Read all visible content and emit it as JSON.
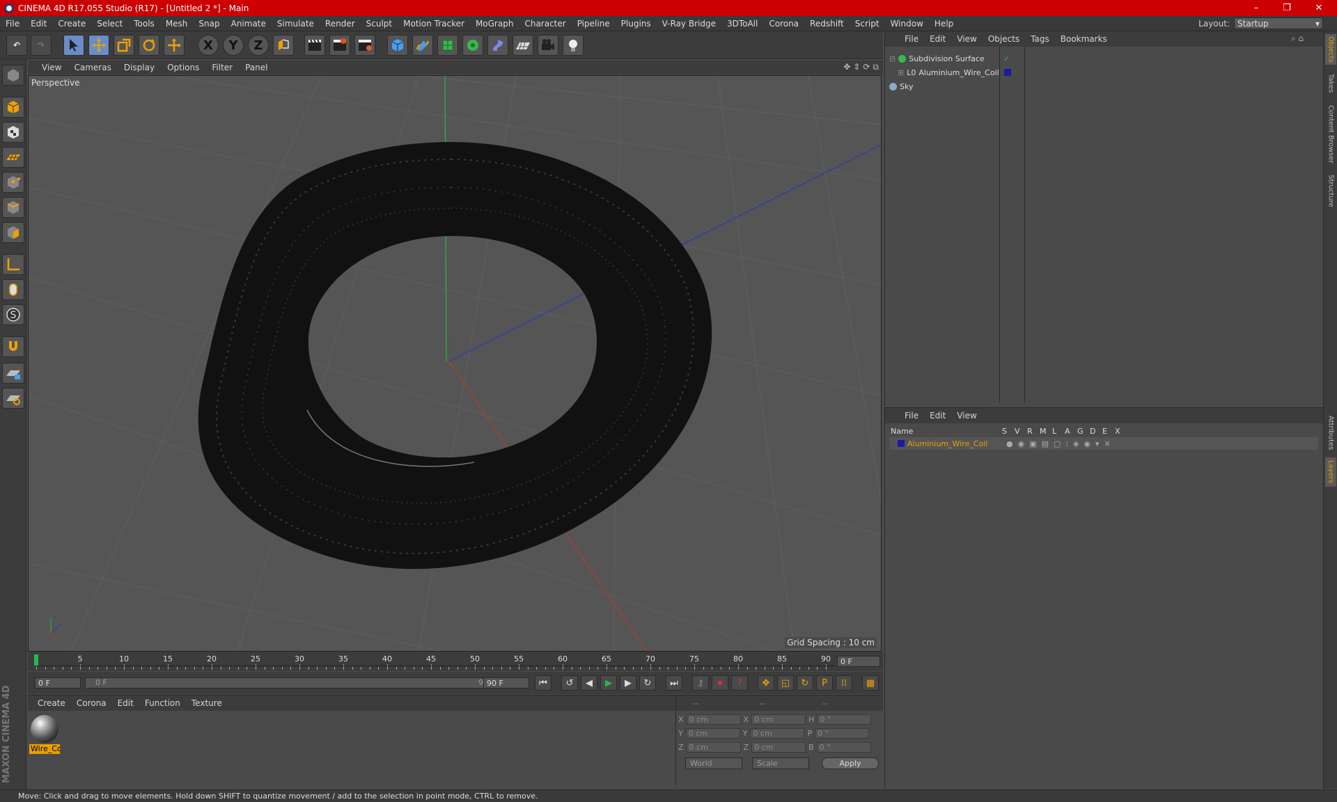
{
  "title": "CINEMA 4D R17.055 Studio (R17) - [Untitled 2 *] - Main",
  "window_controls": {
    "minimize": "–",
    "restore": "❐",
    "close": "✕"
  },
  "menu": [
    "File",
    "Edit",
    "Create",
    "Select",
    "Tools",
    "Mesh",
    "Snap",
    "Animate",
    "Simulate",
    "Render",
    "Sculpt",
    "Motion Tracker",
    "MoGraph",
    "Character",
    "Pipeline",
    "Plugins",
    "V-Ray Bridge",
    "3DToAll",
    "Corona",
    "Redshift",
    "Script",
    "Window",
    "Help"
  ],
  "layout": {
    "label": "Layout:",
    "value": "Startup"
  },
  "toolbar_icons": {
    "undo": "undo-icon",
    "redo": "redo-icon",
    "live_selection": "cursor-icon",
    "move": "move-icon",
    "scale": "scale-icon",
    "rotate": "rotate-icon",
    "axis_x": "X",
    "axis_y": "Y",
    "axis_z": "Z"
  },
  "viewport": {
    "menu": [
      "View",
      "Cameras",
      "Display",
      "Options",
      "Filter",
      "Panel"
    ],
    "label": "Perspective",
    "grid_spacing": "Grid Spacing : 10 cm"
  },
  "timeline": {
    "ticks": [
      "0",
      "5",
      "10",
      "15",
      "20",
      "25",
      "30",
      "35",
      "40",
      "45",
      "50",
      "55",
      "60",
      "65",
      "70",
      "75",
      "80",
      "85",
      "90"
    ],
    "current_frame": "0 F",
    "start_frame": "0 F",
    "range_slider_start": "0 F",
    "range_slider_end": "90 F",
    "end_frame": "90 F"
  },
  "material_panel": {
    "menu": [
      "Create",
      "Corona",
      "Edit",
      "Function",
      "Texture"
    ],
    "materials": [
      {
        "name": "Wire_Co"
      }
    ]
  },
  "coordinates": {
    "headers": [
      "--",
      "--",
      "--"
    ],
    "rows": [
      {
        "a": "X",
        "pos": "0 cm",
        "b": "X",
        "size": "0 cm",
        "c": "H",
        "rot": "0 °"
      },
      {
        "a": "Y",
        "pos": "0 cm",
        "b": "Y",
        "size": "0 cm",
        "c": "P",
        "rot": "0 °"
      },
      {
        "a": "Z",
        "pos": "0 cm",
        "b": "Z",
        "size": "0 cm",
        "c": "B",
        "rot": "0 °"
      }
    ],
    "mode1": "World",
    "mode2": "Scale",
    "apply": "Apply"
  },
  "object_manager": {
    "menu": [
      "File",
      "Edit",
      "View",
      "Objects",
      "Tags",
      "Bookmarks"
    ],
    "objects": [
      {
        "name": "Subdivision Surface",
        "icon": "subdivision-icon"
      },
      {
        "name": "Aluminium_Wire_Coil",
        "icon": "polygon-object-icon",
        "color": "#1a1aaa"
      },
      {
        "name": "Sky",
        "icon": "sky-icon"
      }
    ]
  },
  "layer_manager": {
    "menu": [
      "File",
      "Edit",
      "View"
    ],
    "columns": [
      "Name",
      "S",
      "V",
      "R",
      "M",
      "L",
      "A",
      "G",
      "D",
      "E",
      "X"
    ],
    "layers": [
      {
        "name": "Aluminium_Wire_Coil",
        "color": "#1a1aaa"
      }
    ]
  },
  "side_tabs": [
    "Objects",
    "Takes",
    "Content Browser",
    "Structure",
    "Attributes",
    "Layers"
  ],
  "status": "Move: Click and drag to move elements. Hold down SHIFT to quantize movement / add to the selection in point mode, CTRL to remove.",
  "brand": "MAXON CINEMA 4D"
}
